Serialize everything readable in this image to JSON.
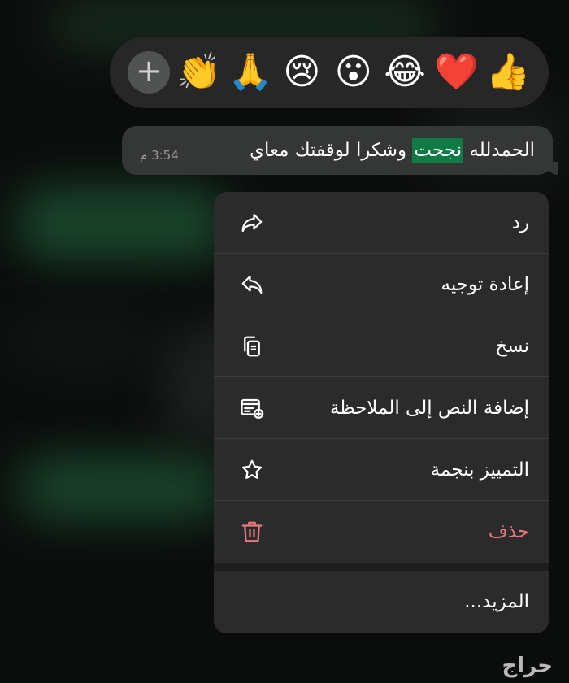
{
  "reactions": {
    "emojis": [
      "👍",
      "❤️",
      "😂",
      "😮",
      "😢",
      "🙏",
      "👏"
    ],
    "add_label": "+"
  },
  "message": {
    "text_before": "الحمدلله ",
    "text_highlight": "نجحت",
    "text_after": " وشكرا لوقفتك معاي",
    "time": "3:54 م"
  },
  "menu": {
    "items": [
      {
        "label": "رد",
        "icon": "reply-icon"
      },
      {
        "label": "إعادة توجيه",
        "icon": "forward-icon"
      },
      {
        "label": "نسخ",
        "icon": "copy-icon"
      },
      {
        "label": "إضافة النص إلى الملاحظة",
        "icon": "add-note-icon"
      },
      {
        "label": "التمييز بنجمة",
        "icon": "star-icon"
      },
      {
        "label": "حذف",
        "icon": "trash-icon"
      }
    ],
    "more_label": "المزيد..."
  },
  "colors": {
    "highlight": "#0f7a45",
    "danger": "#e9777d"
  },
  "watermark": "حراج"
}
